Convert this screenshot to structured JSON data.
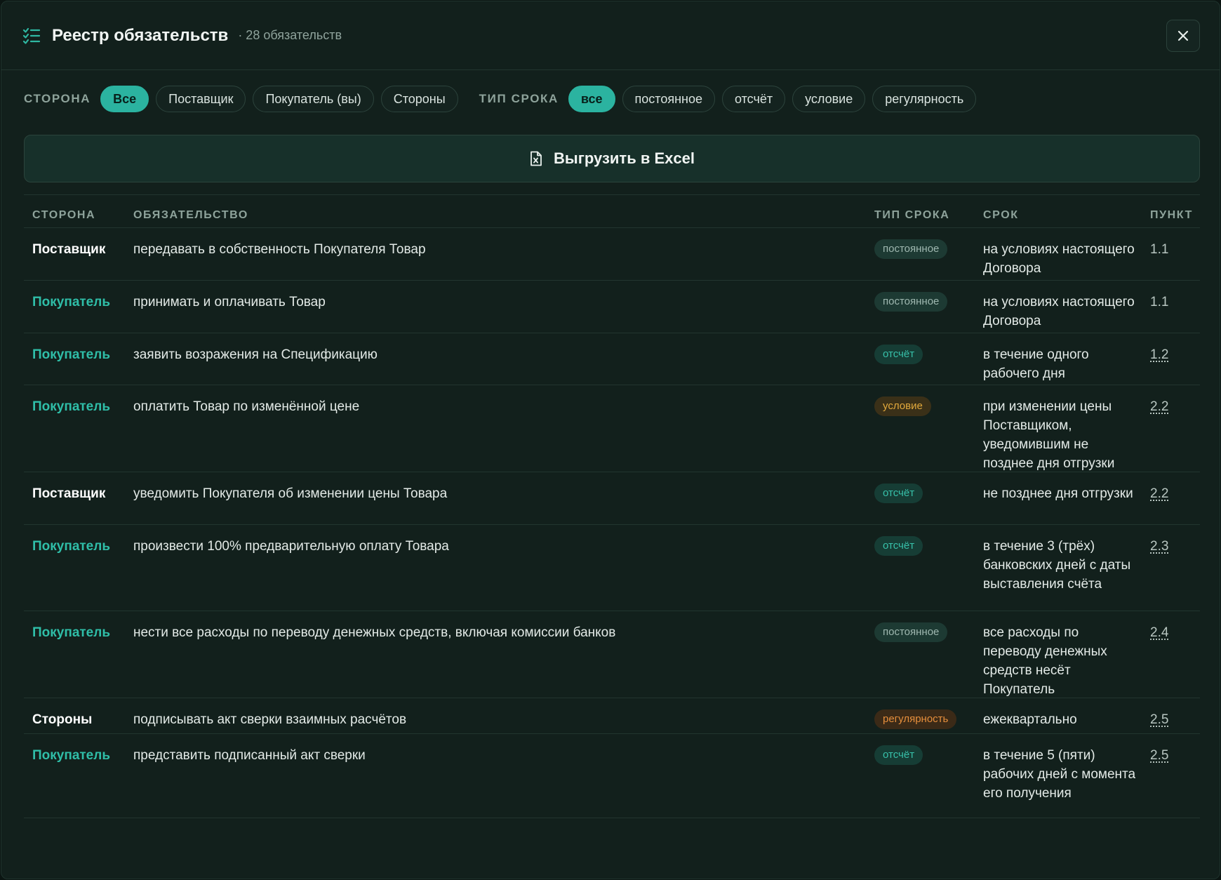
{
  "header": {
    "title": "Реестр обязательств",
    "count": "· 28 обязательств"
  },
  "filters": {
    "party_label": "СТОРОНА",
    "party_options": [
      "Все",
      "Поставщик",
      "Покупатель (вы)",
      "Стороны"
    ],
    "party_selected": "Все",
    "type_label": "ТИП СРОКА",
    "type_options": [
      "все",
      "постоянное",
      "отсчёт",
      "условие",
      "регулярность"
    ],
    "type_selected": "все"
  },
  "export": {
    "label": "Выгрузить в Excel"
  },
  "table": {
    "columns": [
      "СТОРОНА",
      "ОБЯЗАТЕЛЬСТВО",
      "ТИП СРОКА",
      "СРОК",
      "ПУНКТ"
    ],
    "rows": [
      {
        "party": "Поставщик",
        "duty": "передавать в собственность Покупателя Товар",
        "type": "постоянное",
        "term": "на условиях настоящего Договора",
        "clause": "1.1",
        "clause_link": false
      },
      {
        "party": "Покупатель",
        "duty": "принимать и оплачивать Товар",
        "type": "постоянное",
        "term": "на условиях настоящего Договора",
        "clause": "1.1",
        "clause_link": false
      },
      {
        "party": "Покупатель",
        "duty": "заявить возражения на Спецификацию",
        "type": "отсчёт",
        "term": "в течение одного рабочего дня",
        "clause": "1.2",
        "clause_link": true
      },
      {
        "party": "Покупатель",
        "duty": "оплатить Товар по изменённой цене",
        "type": "условие",
        "term": "при изменении цены Поставщиком, уведомившим не позднее дня отгрузки",
        "clause": "2.2",
        "clause_link": true
      },
      {
        "party": "Поставщик",
        "duty": "уведомить Покупателя об изменении цены Товара",
        "type": "отсчёт",
        "term": "не позднее дня отгрузки",
        "clause": "2.2",
        "clause_link": true
      },
      {
        "party": "Покупатель",
        "duty": "произвести 100% предварительную оплату Товара",
        "type": "отсчёт",
        "term": "в течение 3 (трёх) банковских дней с даты выставления счёта",
        "clause": "2.3",
        "clause_link": true
      },
      {
        "party": "Покупатель",
        "duty": "нести все расходы по переводу денежных средств, включая комиссии банков",
        "type": "постоянное",
        "term": "все расходы по переводу денежных средств несёт Покупатель",
        "clause": "2.4",
        "clause_link": true
      },
      {
        "party": "Стороны",
        "duty": "подписывать акт сверки взаимных расчётов",
        "type": "регулярность",
        "term": "ежеквартально",
        "clause": "2.5",
        "clause_link": true
      },
      {
        "party": "Покупатель",
        "duty": "представить подписанный акт сверки",
        "type": "отсчёт",
        "term": "в течение 5 (пяти) рабочих дней с момента его получения",
        "clause": "2.5",
        "clause_link": true
      }
    ]
  },
  "colors": {
    "accent": "#2bb3a0",
    "buyer_text": "#2fbea8",
    "condition_badge": "#e2a93c",
    "regular_badge": "#e68f3c"
  }
}
